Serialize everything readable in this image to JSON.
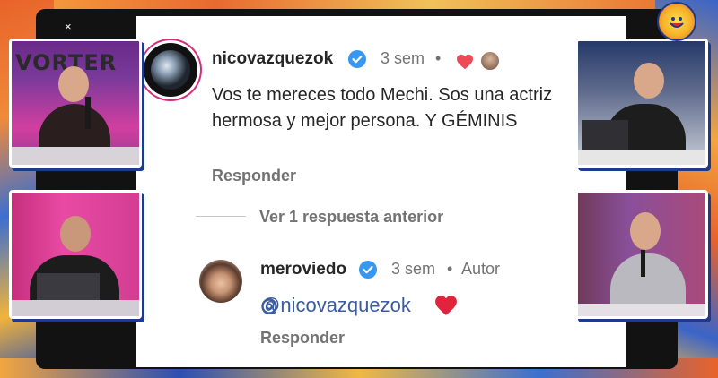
{
  "window": {
    "close_glyph": "×"
  },
  "comments": [
    {
      "username": "nicovazquezok",
      "age": "3 sem",
      "separator": "•",
      "text": "Vos te mereces todo Mechi. Sos una actriz hermosa y mejor persona. Y GÉMINIS",
      "reply_label": "Responder"
    }
  ],
  "thread": {
    "view_replies_label": "Ver 1 respuesta anterior"
  },
  "reply": {
    "username": "meroviedo",
    "age": "3 sem",
    "separator": "•",
    "author_badge": "Autor",
    "mention": "@nicovazquezok",
    "reply_label": "Responder"
  },
  "webcams": {
    "top_left_sign": "VORTER"
  },
  "colors": {
    "verified_blue": "#3897f0",
    "heart_red": "#ed4956",
    "muted_text": "#737373"
  },
  "icons": [
    "close-icon",
    "verified-badge-icon",
    "heart-icon",
    "threads-icon",
    "station-logo-icon"
  ]
}
